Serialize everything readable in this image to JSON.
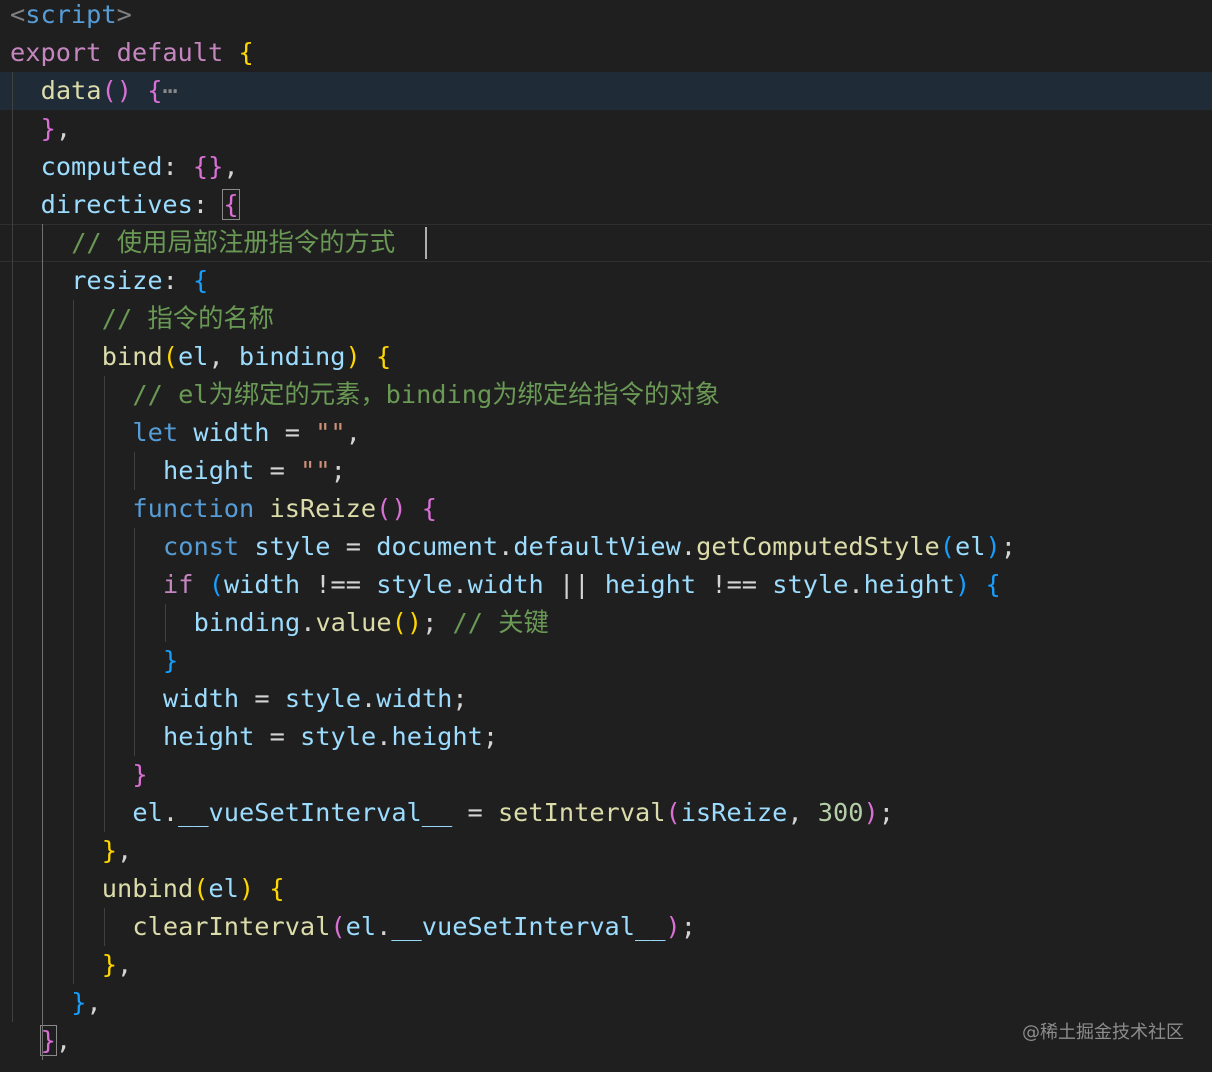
{
  "editor": {
    "language": "javascript (vue)",
    "theme_colors": {
      "background": "#1f1f1f",
      "keyword": "#c586c0",
      "declaration": "#569cd6",
      "function": "#dcdcaa",
      "property": "#9cdcfe",
      "string": "#ce9178",
      "number": "#b5cea8",
      "comment": "#6a9955",
      "bracket_level_1": "#ffd700",
      "bracket_level_2": "#da70d6",
      "bracket_level_3": "#179fff"
    },
    "lines": [
      {
        "text": "<script>"
      },
      {
        "text": "export default {"
      },
      {
        "text": "  data() {"
      },
      {
        "text": "  },"
      },
      {
        "text": "  computed: {},"
      },
      {
        "text": "  directives: {"
      },
      {
        "text": "    // 使用局部注册指令的方式"
      },
      {
        "text": "    resize: {"
      },
      {
        "text": "      // 指令的名称"
      },
      {
        "text": "      bind(el, binding) {"
      },
      {
        "text": "        // el为绑定的元素，binding为绑定给指令的对象"
      },
      {
        "text": "        let width = \"\","
      },
      {
        "text": "          height = \"\";"
      },
      {
        "text": "        function isReize() {"
      },
      {
        "text": "          const style = document.defaultView.getComputedStyle(el);"
      },
      {
        "text": "          if (width !== style.width || height !== style.height) {"
      },
      {
        "text": "            binding.value(); // 关键"
      },
      {
        "text": "          }"
      },
      {
        "text": "          width = style.width;"
      },
      {
        "text": "          height = style.height;"
      },
      {
        "text": "        }"
      },
      {
        "text": "        el.__vueSetInterval__ = setInterval(isReize, 300);"
      },
      {
        "text": "      },"
      },
      {
        "text": "      unbind(el) {"
      },
      {
        "text": "        clearInterval(el.__vueSetInterval__);"
      },
      {
        "text": "      },"
      },
      {
        "text": "    },"
      },
      {
        "text": "  },"
      }
    ],
    "folded_marker": "⋯"
  },
  "watermark": "@稀土掘金技术社区"
}
